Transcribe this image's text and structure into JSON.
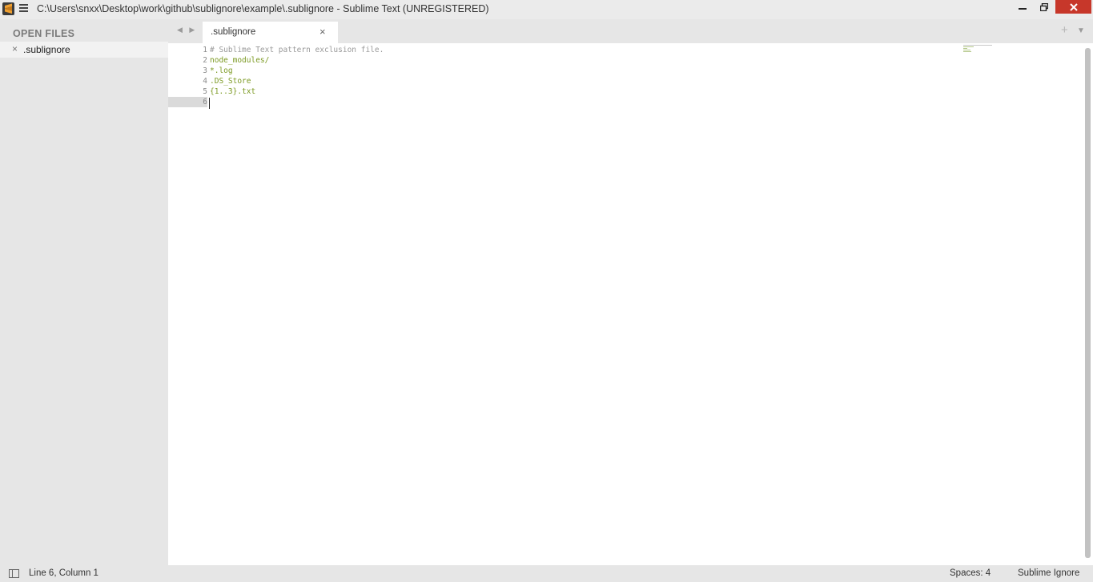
{
  "window": {
    "title": "C:\\Users\\snxx\\Desktop\\work\\github\\sublignore\\example\\.sublignore - Sublime Text (UNREGISTERED)",
    "controls": {
      "minimize": "minimize-icon",
      "maximize": "restore-icon",
      "close": "close-icon"
    }
  },
  "sidebar": {
    "heading": "OPEN FILES",
    "files": [
      {
        "close": "×",
        "name": ".sublignore"
      }
    ]
  },
  "tabbar": {
    "nav": "◀ ▶",
    "tabs": [
      {
        "label": ".sublignore",
        "close": "×"
      }
    ],
    "add": "+",
    "more": "▼"
  },
  "editor": {
    "line_numbers": [
      "1",
      "2",
      "3",
      "4",
      "5",
      "6"
    ],
    "lines": [
      "# Sublime Text pattern exclusion file.",
      "node_modules/",
      "*.log",
      ".DS_Store",
      "{1..3}.txt",
      ""
    ],
    "current_line": 6
  },
  "statusbar": {
    "position": "Line 6, Column 1",
    "spaces": "Spaces: 4",
    "syntax": "Sublime Ignore"
  },
  "colors": {
    "comment": "#9a9a9a",
    "pattern": "#7c9a23",
    "close_button": "#c7372a",
    "app_icon": "#f0a030"
  }
}
